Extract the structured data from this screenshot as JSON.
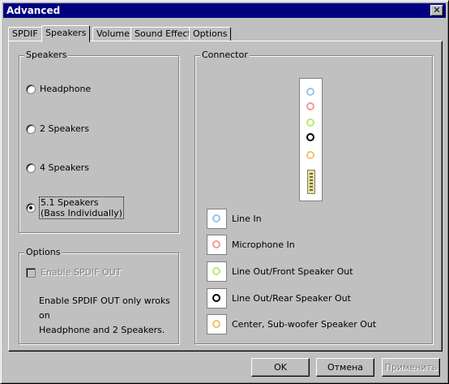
{
  "window": {
    "title": "Advanced",
    "close_glyph": "✕"
  },
  "tabs": [
    "SPDIF",
    "Speakers",
    "Volume",
    "Sound Effect",
    "Options"
  ],
  "active_tab": "Speakers",
  "speakers_group": {
    "title": "Speakers",
    "options": [
      {
        "label": "Headphone",
        "checked": false
      },
      {
        "label": "2 Speakers",
        "checked": false
      },
      {
        "label": "4 Speakers",
        "checked": false
      },
      {
        "label_line1": "5.1 Speakers",
        "label_line2": "(Bass Individually)",
        "checked": true
      }
    ]
  },
  "options_group": {
    "title": "Options",
    "checkbox_label": "Enable SPDIF OUT",
    "checkbox_checked": false,
    "checkbox_enabled": false,
    "note_line1": "Enable SPDIF OUT only wroks on",
    "note_line2": "Headphone and 2 Speakers."
  },
  "connector_group": {
    "title": "Connector",
    "legend": [
      {
        "label": "Line In",
        "color": "#9ec4e6"
      },
      {
        "label": "Microphone In",
        "color": "#f29a9a"
      },
      {
        "label": "Line Out/Front Speaker Out",
        "color": "#b8ec6a"
      },
      {
        "label": "Line Out/Rear Speaker Out",
        "color": "#000000"
      },
      {
        "label": "Center, Sub-woofer Speaker Out",
        "color": "#f0c070"
      }
    ]
  },
  "buttons": {
    "ok": "OK",
    "cancel": "Отмена",
    "apply": "Применить"
  }
}
